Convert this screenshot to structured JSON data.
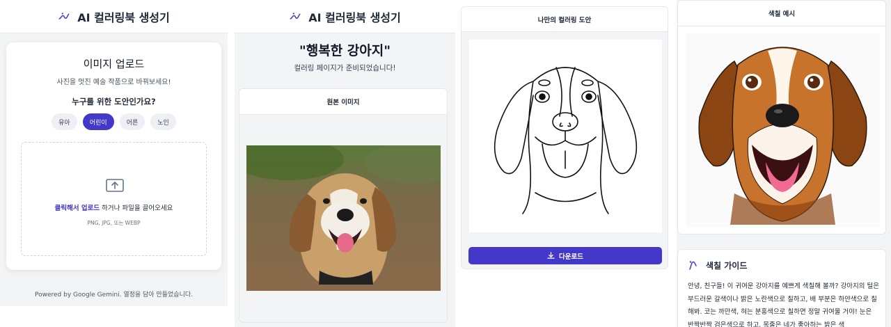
{
  "app": {
    "title": "AI 컬러링북 생성기"
  },
  "upload": {
    "title": "이미지 업로드",
    "subtitle": "사진을 멋진 예술 작품으로 바꿔보세요!",
    "question": "누구를 위한 도안인가요?",
    "ages": [
      {
        "label": "유아",
        "active": false
      },
      {
        "label": "어린이",
        "active": true
      },
      {
        "label": "어른",
        "active": false
      },
      {
        "label": "노인",
        "active": false
      }
    ],
    "drop_link": "클릭해서 업로드",
    "drop_text": " 하거나 파일을 끌어오세요",
    "drop_hint": "PNG, JPG, 또는 WEBP"
  },
  "footer": {
    "text": "Powered by Google Gemini. 열정을 담아 만들었습니다."
  },
  "result": {
    "title": "\"행복한 강아지\"",
    "subtitle": "컬러링 페이지가 준비되었습니다!",
    "original_label": "원본 이미지",
    "coloring_label": "나만의 컬러링 도안",
    "download_label": "다운로드",
    "example_label": "색칠 예시"
  },
  "guide": {
    "title": "색칠 가이드",
    "text": "안녕, 친구들! 이 귀여운 강아지를 예쁘게 색칠해 볼까? 강아지의 털은 부드러운 갈색이나 밝은 노란색으로 칠하고, 배 부분은 하얀색으로 칠해봐. 코는 까만색, 혀는 분홍색으로 칠하면 정말 귀여울 거야! 눈은 반짝반짝 검은색으로 하고, 목줄은 네가 좋아하는 밝은 색"
  },
  "colors": {
    "accent": "#4338ca",
    "background": "#f3f4f6"
  }
}
